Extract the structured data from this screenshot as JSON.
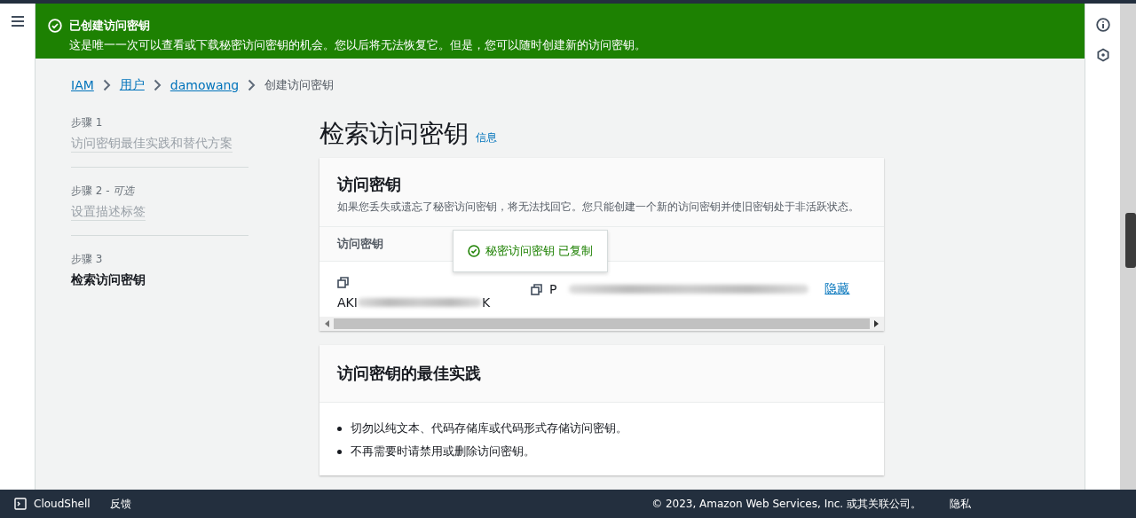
{
  "banner": {
    "title": "已创建访问密钥",
    "message": "这是唯一一次可以查看或下载秘密访问密钥的机会。您以后将无法恢复它。但是，您可以随时创建新的访问密钥。"
  },
  "breadcrumbs": [
    {
      "label": "IAM",
      "kind": "link"
    },
    {
      "label": "用户",
      "kind": "link"
    },
    {
      "label": "damowang",
      "kind": "link"
    },
    {
      "label": "创建访问密钥",
      "kind": "current"
    }
  ],
  "steps": [
    {
      "step": "步骤 1",
      "title": "访问密钥最佳实践和替代方案",
      "selected": false
    },
    {
      "step": "步骤 2 - ",
      "optional": "可选",
      "title": "设置描述标签",
      "selected": false
    },
    {
      "step": "步骤 3",
      "title": "检索访问密钥",
      "selected": true
    }
  ],
  "page": {
    "title": "检索访问密钥",
    "info": "信息"
  },
  "keys_card": {
    "title": "访问密钥",
    "description": "如果您丢失或遗忘了秘密访问密钥，将无法找回它。您只能创建一个新的访问密钥并使旧密钥处于非活跃状态。",
    "column": "访问密钥",
    "access_key_start": "AKI",
    "access_key_end": "K",
    "secret_key_start": "P",
    "hide_link": "隐藏",
    "popover": "秘密访问密钥 已复制"
  },
  "practices_card": {
    "title": "访问密钥的最佳实践",
    "items": [
      "切勿以纯文本、代码存储库或代码形式存储访问密钥。",
      "不再需要时请禁用或删除访问密钥。"
    ]
  },
  "footer": {
    "cloudshell": "CloudShell",
    "feedback": "反馈",
    "copyright": "© 2023, Amazon Web Services, Inc. 或其关联公司。",
    "privacy": "隐私"
  }
}
